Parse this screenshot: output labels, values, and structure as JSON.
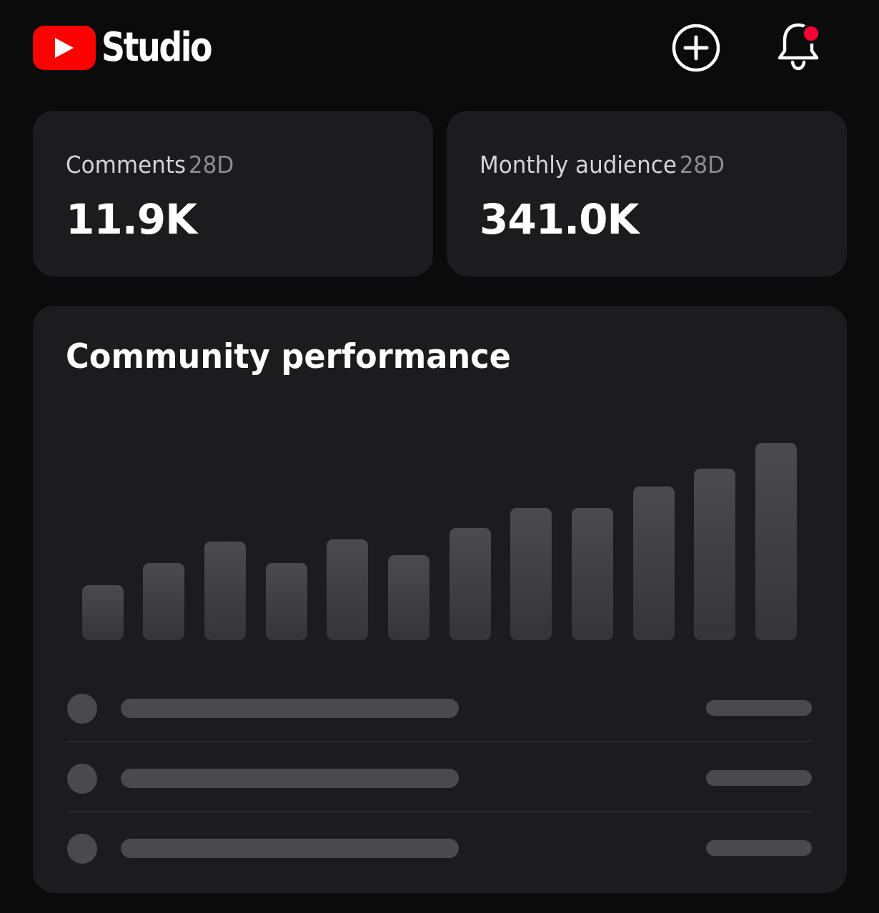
{
  "header": {
    "logo_text": "Studio",
    "icons": {
      "logo": "youtube-play-icon",
      "create": "add-circle-icon",
      "notifications": "bell-icon"
    },
    "notification_badge_color": "#ff0033",
    "brand_color": "#ff0000"
  },
  "stats": [
    {
      "label": "Comments",
      "period": "28D",
      "value": "11.9K"
    },
    {
      "label": "Monthly audience",
      "period": "28D",
      "value": "341.0K"
    }
  ],
  "performance": {
    "title": "Community performance",
    "list_row_count": 3
  },
  "chart_data": {
    "type": "bar",
    "title": "",
    "xlabel": "",
    "ylabel": "",
    "ylim": [
      0,
      100
    ],
    "grid": false,
    "values": [
      28,
      39,
      50,
      39,
      51,
      43,
      57,
      67,
      67,
      78,
      87,
      100
    ]
  }
}
